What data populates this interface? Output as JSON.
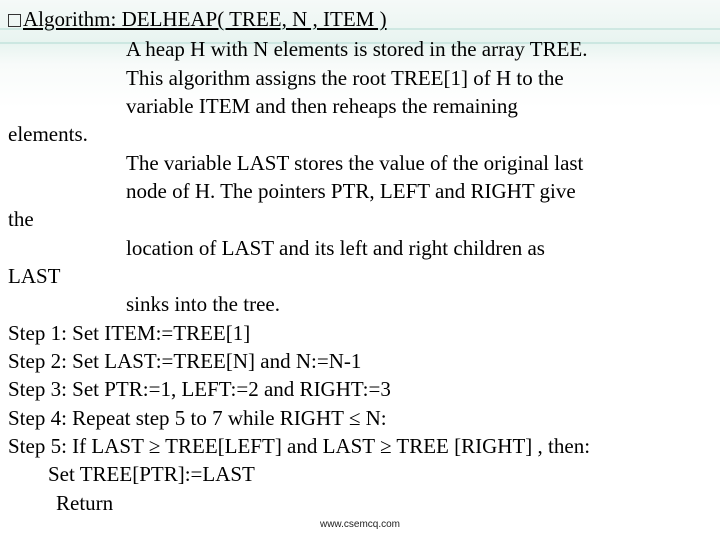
{
  "title": "Algorithm: DELHEAP( TREE, N , ITEM )",
  "desc": {
    "l1": "A heap H with N elements is stored in the array TREE.",
    "l2": "This algorithm assigns the root TREE[1] of H to the",
    "l3": "variable ITEM and then reheaps the remaining",
    "hang1": "elements.",
    "l4": "The variable LAST stores the value of the original last",
    "l5": "node of H. The pointers PTR, LEFT and RIGHT  give",
    "hang2": "the",
    "l6": "location of LAST and its left and right children as",
    "hang3": "LAST",
    "l7": "sinks into the tree."
  },
  "steps": {
    "s1": "Step 1: Set ITEM:=TREE[1]",
    "s2": "Step 2: Set LAST:=TREE[N] and N:=N-1",
    "s3": "Step 3: Set PTR:=1, LEFT:=2 and RIGHT:=3",
    "s4": "Step 4: Repeat step 5 to 7 while RIGHT ≤ N:",
    "s5": "Step 5: If LAST ≥ TREE[LEFT] and LAST ≥ TREE [RIGHT] , then:",
    "s5a": "Set TREE[PTR]:=LAST",
    "s5b": "Return"
  },
  "footer": "www.csemcq.com"
}
